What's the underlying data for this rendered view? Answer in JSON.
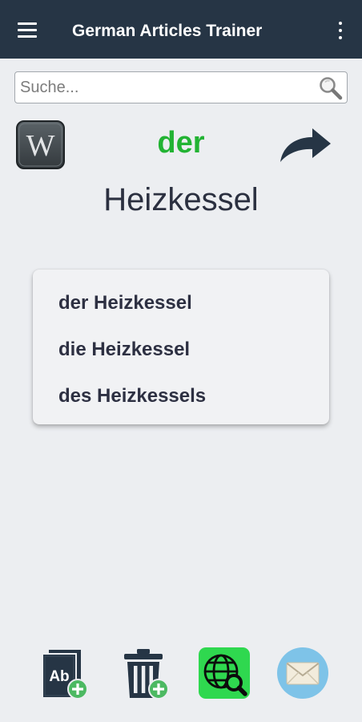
{
  "appbar": {
    "title": "German Articles Trainer"
  },
  "search": {
    "placeholder": "Suche..."
  },
  "word": {
    "article": "der",
    "noun": "Heizkessel",
    "article_color": "#22b333"
  },
  "declensions": [
    "der Heizkessel",
    "die Heizkessel",
    "des Heizkessels"
  ],
  "icons": {
    "menu": "hamburger-menu-icon",
    "overflow": "more-vert-icon",
    "search": "magnifier-icon",
    "wikipedia": "wikipedia-w-icon",
    "share": "curved-arrow-right-icon",
    "add_dictionary": "dictionary-ab-plus-icon",
    "delete": "trash-plus-icon",
    "web_search": "globe-search-icon",
    "mail": "envelope-icon"
  },
  "colors": {
    "appbar": "#263545",
    "accent_green": "#22b333",
    "icon_dark": "#263545",
    "web_green": "#2fd84f",
    "mail_blue": "#7ec3e8"
  }
}
